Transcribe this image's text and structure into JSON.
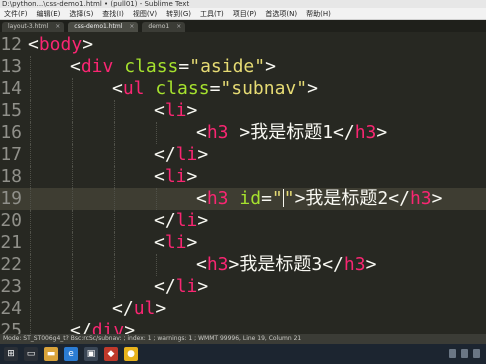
{
  "window": {
    "title": "D:\\python...\\css-demo1.html • (pull01) - Sublime Text",
    "menu": [
      "文件(F)",
      "编辑(E)",
      "选择(S)",
      "查找(I)",
      "视图(V)",
      "转到(G)",
      "工具(T)",
      "项目(P)",
      "首选项(N)",
      "帮助(H)"
    ]
  },
  "tabs": [
    {
      "label": "layout-3.html",
      "active": false
    },
    {
      "label": "css-demo1.html",
      "active": true
    },
    {
      "label": "demo1",
      "active": false
    }
  ],
  "editor": {
    "lines": [
      {
        "num": "12",
        "indent": 0,
        "current": false,
        "tokens": [
          {
            "c": "t-text",
            "s": "<"
          },
          {
            "c": "t-tag",
            "s": "body"
          },
          {
            "c": "t-text",
            "s": ">"
          }
        ]
      },
      {
        "num": "13",
        "indent": 1,
        "current": false,
        "tokens": [
          {
            "c": "t-text",
            "s": "<"
          },
          {
            "c": "t-tag",
            "s": "div"
          },
          {
            "c": "t-text",
            "s": " "
          },
          {
            "c": "t-attr",
            "s": "class"
          },
          {
            "c": "t-text",
            "s": "="
          },
          {
            "c": "t-str",
            "s": "\"aside\""
          },
          {
            "c": "t-text",
            "s": ">"
          }
        ]
      },
      {
        "num": "14",
        "indent": 2,
        "current": false,
        "tokens": [
          {
            "c": "t-text",
            "s": "<"
          },
          {
            "c": "t-tag",
            "s": "ul"
          },
          {
            "c": "t-text",
            "s": " "
          },
          {
            "c": "t-attr",
            "s": "class"
          },
          {
            "c": "t-text",
            "s": "="
          },
          {
            "c": "t-str",
            "s": "\"subnav\""
          },
          {
            "c": "t-text",
            "s": ">"
          }
        ]
      },
      {
        "num": "15",
        "indent": 3,
        "current": false,
        "tokens": [
          {
            "c": "t-text",
            "s": "<"
          },
          {
            "c": "t-tag",
            "s": "li"
          },
          {
            "c": "t-text",
            "s": ">"
          }
        ]
      },
      {
        "num": "16",
        "indent": 4,
        "current": false,
        "tokens": [
          {
            "c": "t-text",
            "s": "<"
          },
          {
            "c": "t-tag",
            "s": "h3"
          },
          {
            "c": "t-text",
            "s": " >我是标题1</"
          },
          {
            "c": "t-tag",
            "s": "h3"
          },
          {
            "c": "t-text",
            "s": ">"
          }
        ]
      },
      {
        "num": "17",
        "indent": 3,
        "current": false,
        "tokens": [
          {
            "c": "t-text",
            "s": "</"
          },
          {
            "c": "t-tag",
            "s": "li"
          },
          {
            "c": "t-text",
            "s": ">"
          }
        ]
      },
      {
        "num": "18",
        "indent": 3,
        "current": false,
        "tokens": [
          {
            "c": "t-text",
            "s": "<"
          },
          {
            "c": "t-tag",
            "s": "li"
          },
          {
            "c": "t-text",
            "s": ">"
          }
        ]
      },
      {
        "num": "19",
        "indent": 4,
        "current": true,
        "tokens": [
          {
            "c": "t-text",
            "s": "<"
          },
          {
            "c": "t-tag",
            "s": "h3"
          },
          {
            "c": "t-text",
            "s": " "
          },
          {
            "c": "t-attr",
            "s": "id"
          },
          {
            "c": "t-text",
            "s": "="
          },
          {
            "c": "t-str",
            "s": "\""
          },
          {
            "c": "cursor",
            "s": ""
          },
          {
            "c": "t-str",
            "s": "\""
          },
          {
            "c": "t-text",
            "s": ">我是标题2</"
          },
          {
            "c": "t-tag",
            "s": "h3"
          },
          {
            "c": "t-text",
            "s": ">"
          }
        ]
      },
      {
        "num": "20",
        "indent": 3,
        "current": false,
        "tokens": [
          {
            "c": "t-text",
            "s": "</"
          },
          {
            "c": "t-tag",
            "s": "li"
          },
          {
            "c": "t-text",
            "s": ">"
          }
        ]
      },
      {
        "num": "21",
        "indent": 3,
        "current": false,
        "tokens": [
          {
            "c": "t-text",
            "s": "<"
          },
          {
            "c": "t-tag",
            "s": "li"
          },
          {
            "c": "t-text",
            "s": ">"
          }
        ]
      },
      {
        "num": "22",
        "indent": 4,
        "current": false,
        "tokens": [
          {
            "c": "t-text",
            "s": "<"
          },
          {
            "c": "t-tag",
            "s": "h3"
          },
          {
            "c": "t-text",
            "s": ">我是标题3</"
          },
          {
            "c": "t-tag",
            "s": "h3"
          },
          {
            "c": "t-text",
            "s": ">"
          }
        ]
      },
      {
        "num": "23",
        "indent": 3,
        "current": false,
        "tokens": [
          {
            "c": "t-text",
            "s": "</"
          },
          {
            "c": "t-tag",
            "s": "li"
          },
          {
            "c": "t-text",
            "s": ">"
          }
        ]
      },
      {
        "num": "24",
        "indent": 2,
        "current": false,
        "tokens": [
          {
            "c": "t-text",
            "s": "</"
          },
          {
            "c": "t-tag",
            "s": "ul"
          },
          {
            "c": "t-text",
            "s": ">"
          }
        ]
      },
      {
        "num": "25",
        "indent": 1,
        "current": false,
        "tokens": [
          {
            "c": "t-text",
            "s": "</"
          },
          {
            "c": "t-tag",
            "s": "div"
          },
          {
            "c": "t-text",
            "s": ">"
          }
        ]
      }
    ]
  },
  "statusbar": {
    "text": "Mode: ST_ST006g4_t? Bsc:rcSc/subnav: ; index: 1 ; warnings: 1 ; WMMT 99996, Line 19, Column 21"
  },
  "taskbar": {
    "icons": [
      {
        "name": "windows-start-icon",
        "glyph": "⊞",
        "color": "#2a2f36"
      },
      {
        "name": "task-view-icon",
        "glyph": "▭",
        "color": "#2a2f36"
      },
      {
        "name": "file-explorer-icon",
        "glyph": "▬",
        "color": "#d9a33a"
      },
      {
        "name": "edge-browser-icon",
        "glyph": "e",
        "color": "#2b7cd3"
      },
      {
        "name": "store-icon",
        "glyph": "▣",
        "color": "#3b4756"
      },
      {
        "name": "app-icon",
        "glyph": "◆",
        "color": "#c0392b"
      },
      {
        "name": "chrome-icon",
        "glyph": "●",
        "color": "#e8b31c"
      }
    ]
  },
  "theme": {
    "background": "#272822",
    "tag_color": "#f92672",
    "attr_color": "#a6e22e",
    "string_color": "#e6db74",
    "text_color": "#f8f8f2"
  }
}
